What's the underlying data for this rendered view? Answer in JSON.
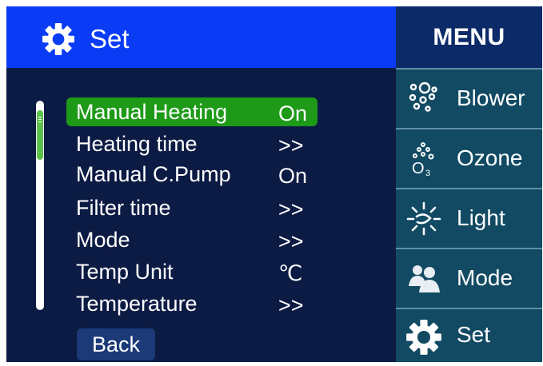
{
  "header": {
    "title": "Set",
    "icon": "gear-icon"
  },
  "settings": {
    "items": [
      {
        "label": "Manual Heating",
        "value": "On",
        "selected": true
      },
      {
        "label": "Heating time",
        "value": ">>"
      },
      {
        "label": "Manual C.Pump",
        "value": "On"
      },
      {
        "label": "Filter time",
        "value": ">>"
      },
      {
        "label": "Mode",
        "value": ">>"
      },
      {
        "label": "Temp Unit",
        "value": "℃"
      },
      {
        "label": "Temperature",
        "value": ">>"
      }
    ],
    "back_label": "Back"
  },
  "menu": {
    "title": "MENU",
    "items": [
      {
        "label": "Blower",
        "icon": "blower-icon"
      },
      {
        "label": "Ozone",
        "icon": "ozone-icon"
      },
      {
        "label": "Light",
        "icon": "light-icon"
      },
      {
        "label": "Mode",
        "icon": "mode-icon"
      },
      {
        "label": "Set",
        "icon": "gear-icon"
      }
    ]
  },
  "colors": {
    "header_bg": "#0b3cf5",
    "screen_bg": "#0c1b44",
    "selected_bg": "#1e9a18",
    "menu_bg": "#124a63",
    "menu_header_bg": "#0d2a68"
  }
}
